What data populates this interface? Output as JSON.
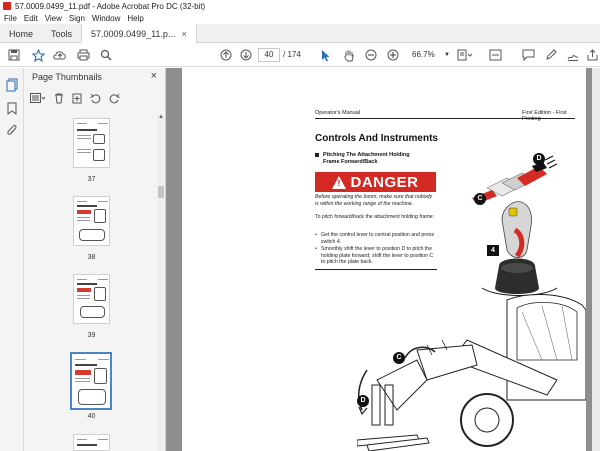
{
  "window": {
    "title": "57.0009.0499_11.pdf - Adobe Acrobat Pro DC (32-bit)"
  },
  "menu": [
    "File",
    "Edit",
    "View",
    "Sign",
    "Window",
    "Help"
  ],
  "tabs": {
    "home": "Home",
    "tools": "Tools",
    "document": "57.0009.0499_11.p...",
    "close": "×"
  },
  "toolbar": {
    "current_page": "40",
    "page_separator": "/",
    "page_count": "174",
    "zoom": "66.7%"
  },
  "thumbnails_panel": {
    "title": "Page Thumbnails",
    "close": "×",
    "pages": [
      {
        "label": "37",
        "selected": false
      },
      {
        "label": "38",
        "selected": false
      },
      {
        "label": "39",
        "selected": false
      },
      {
        "label": "40",
        "selected": true
      }
    ]
  },
  "document": {
    "header_left": "Operator's Manual",
    "header_right": "First Edition - First Printing",
    "section_title": "Controls And Instruments",
    "subheading": "Pitching The Attachment Holding Frame Forward/Back",
    "danger_label": "DANGER",
    "danger_note": "Before operating the boom, make sure that nobody is within the working range of the machine.",
    "intro": "To pitch forward/back the attachment holding frame:",
    "steps": [
      "Get the control lever to central position and press switch 4.",
      "Smoothly shift the lever to position D to pitch the holding plate forward; shift the lever to position C to pitch the plate back."
    ],
    "callouts": {
      "d": "D",
      "c": "C",
      "four": "4"
    }
  }
}
